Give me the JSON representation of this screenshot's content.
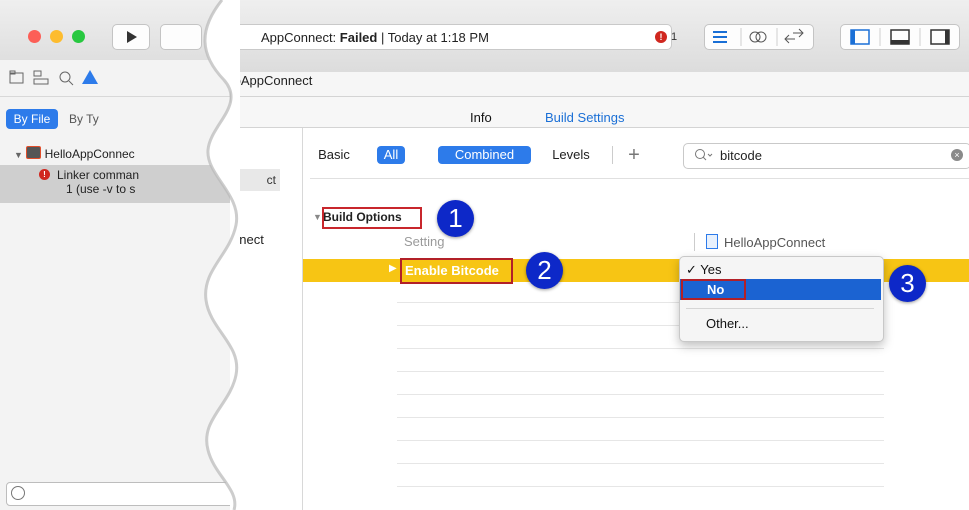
{
  "toolbar": {
    "status_prefix": "AppConnect: ",
    "status_result": "Failed",
    "status_suffix": "  |  Today at 1:18 PM",
    "error_count": "1"
  },
  "jumpbar": {
    "text": ".oAppConnect"
  },
  "editor_tabs": {
    "info": "Info",
    "build_settings": "Build Settings"
  },
  "navigator": {
    "by_file": "By File",
    "by_type": "By Ty",
    "project": "HelloAppConnec",
    "issue_line1": "Linker comman",
    "issue_line2": "1 (use -v to s"
  },
  "targets": {
    "item1": "ct",
    "item2": "nnect"
  },
  "filter_bar": {
    "basic": "Basic",
    "all": "All",
    "combined": "Combined",
    "levels": "Levels",
    "add": "+",
    "search_value": "bitcode"
  },
  "settings": {
    "section": "Build Options",
    "setting_header": "Setting",
    "project_header": "HelloAppConnect",
    "row_name": "Enable Bitcode"
  },
  "popup_menu": {
    "yes": "Yes",
    "yes_check": "✓",
    "no": "No",
    "other": "Other..."
  },
  "callouts": [
    "1",
    "2",
    "3"
  ],
  "colors": {
    "accent": "#2d7bea",
    "highlight_row": "#f7c514",
    "annotation_red": "#c8262c",
    "callout_blue": "#0d28c8"
  }
}
